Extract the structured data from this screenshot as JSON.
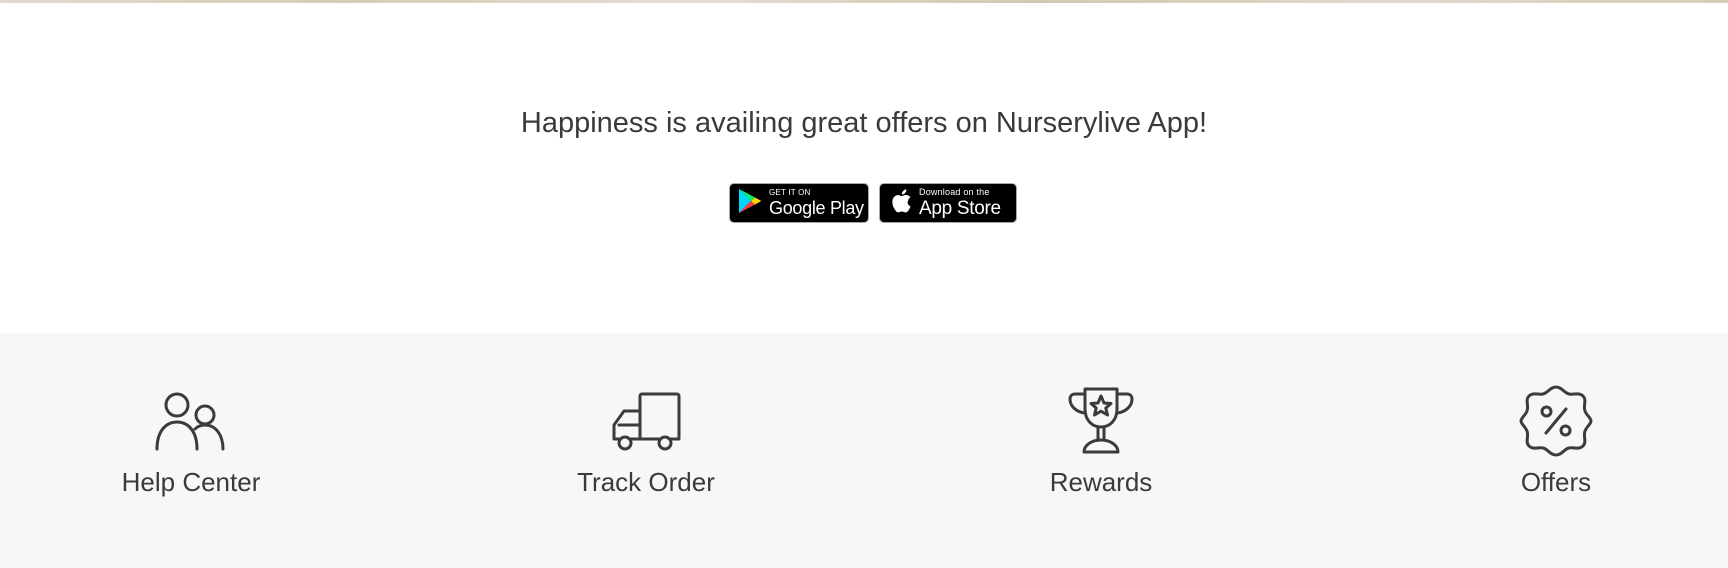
{
  "app_promo": {
    "title": "Happiness is availing great offers on Nurserylive App!",
    "google_play": {
      "small_text": "GET IT ON",
      "big_text": "Google Play",
      "icon": "google-play-icon"
    },
    "app_store": {
      "small_text": "Download on the",
      "big_text": "App Store",
      "icon": "apple-icon"
    }
  },
  "quick_links": [
    {
      "label": "Help Center",
      "icon": "people-icon"
    },
    {
      "label": "Track Order",
      "icon": "truck-icon"
    },
    {
      "label": "Rewards",
      "icon": "trophy-icon"
    },
    {
      "label": "Offers",
      "icon": "percent-badge-icon"
    }
  ],
  "colors": {
    "text": "#3a3a3a",
    "footer_bg": "#f7f7f7",
    "badge_bg": "#000000"
  }
}
